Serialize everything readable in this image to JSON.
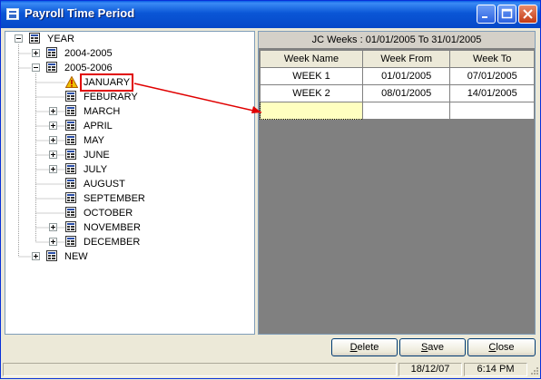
{
  "window": {
    "title": "Payroll Time Period"
  },
  "tree": {
    "root_label": "YEAR",
    "years": [
      {
        "label": "2004-2005"
      },
      {
        "label": "2005-2006"
      },
      {
        "label": "NEW"
      }
    ],
    "months": [
      "JANUARY",
      "FEBURARY",
      "MARCH",
      "APRIL",
      "MAY",
      "JUNE",
      "JULY",
      "AUGUST",
      "SEPTEMBER",
      "OCTOBER",
      "NOVEMBER",
      "DECEMBER"
    ]
  },
  "grid": {
    "caption": "JC Weeks : 01/01/2005 To 31/01/2005",
    "headers": [
      "Week Name",
      "Week From",
      "Week To"
    ],
    "rows": [
      [
        "WEEK 1",
        "01/01/2005",
        "07/01/2005"
      ],
      [
        "WEEK 2",
        "08/01/2005",
        "14/01/2005"
      ]
    ]
  },
  "buttons": {
    "delete": {
      "first": "D",
      "rest": "elete"
    },
    "save": {
      "first": "S",
      "rest": "ave"
    },
    "close": {
      "first": "C",
      "rest": "lose"
    }
  },
  "status": {
    "date": "18/12/07",
    "time": "6:14 PM"
  },
  "colors": {
    "title_bar": "#0a56d6",
    "highlight_border": "#e00000",
    "edit_cell": "#ffffc0"
  }
}
